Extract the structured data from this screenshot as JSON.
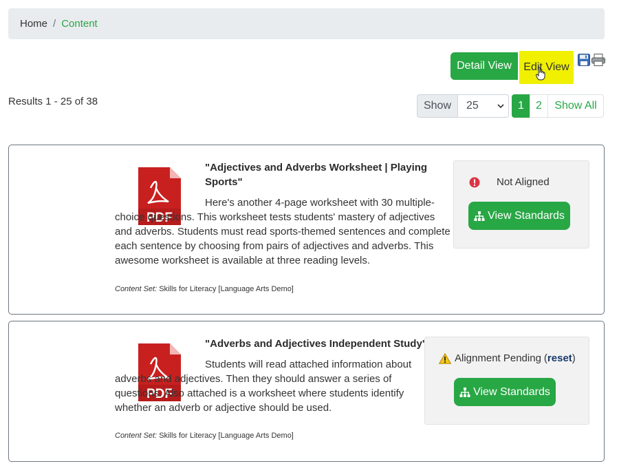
{
  "breadcrumb": {
    "home": "Home",
    "separator": "/",
    "current": "Content"
  },
  "toolbar": {
    "detail_view": "Detail View",
    "edit_view": "Edit View",
    "save_icon": "save-icon",
    "print_icon": "print-icon"
  },
  "results": {
    "text": "Results 1 - 25 of 38"
  },
  "show": {
    "label": "Show",
    "value": "25"
  },
  "pagination": {
    "pages": [
      "1",
      "2"
    ],
    "show_all": "Show All",
    "active": "1"
  },
  "colors": {
    "accent": "#28a745",
    "highlight": "#f0f000",
    "breadcrumb_bg": "#e9ecef"
  },
  "items": [
    {
      "icon": "pdf-icon",
      "title_line1": "\"Adjectives and Adverbs Worksheet | Playing",
      "title_line2": "Sports\"",
      "description": "Here's another 4-page worksheet with 30 multiple-choice questions. This worksheet tests students' mastery of adjectives and adverbs. Students must read sports-themed sentences and complete each sentence by choosing from pairs of adjectives and adverbs. This awesome worksheet is available at three reading levels.",
      "content_set_label": "Content Set:",
      "content_set_value": "Skills for Literacy [Language Arts Demo]",
      "status": "Not Aligned",
      "button": "View Standards"
    },
    {
      "icon": "pdf-icon",
      "title_line1": "\"Adverbs and Adjectives Independent Study\"",
      "description": "Students will read attached information about adverbs and adjectives. Then they should answer a series of questions. Also attached is a worksheet where students identify whether an adverb or adjective should be used.",
      "content_set_label": "Content Set:",
      "content_set_value": "Skills for Literacy [Language Arts Demo]",
      "status": "Alignment Pending",
      "status_open": "(",
      "status_link": "reset",
      "status_close": ")",
      "button": "View Standards"
    }
  ]
}
